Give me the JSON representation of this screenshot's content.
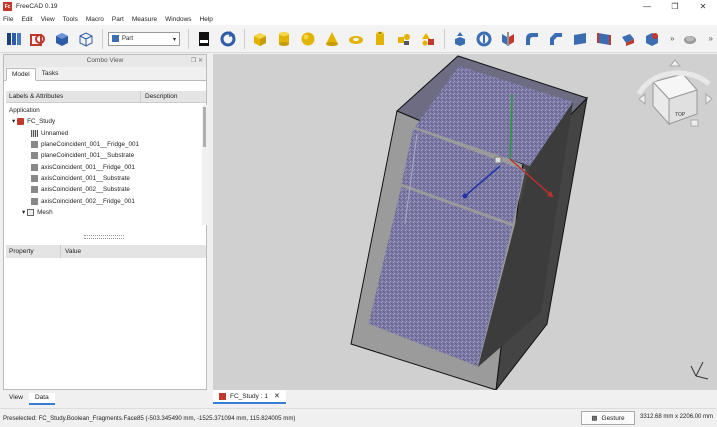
{
  "window": {
    "title": "FreeCAD 0.19",
    "app_icon": "Fc"
  },
  "menu": [
    "File",
    "Edit",
    "View",
    "Tools",
    "Macro",
    "Part",
    "Measure",
    "Windows",
    "Help"
  ],
  "toolbar": {
    "workbench": "Part",
    "icons": [
      "new-document-icon",
      "open-icon",
      "box-view-icon",
      "wireframe-icon",
      "workbench-select",
      "pdf-export-icon",
      "refresh-icon",
      "cube-icon",
      "cylinder-icon",
      "sphere-icon",
      "cone-icon",
      "torus-icon",
      "tube-icon",
      "shape-builder-icon",
      "primitives-icon",
      "extrude-icon",
      "revolve-icon",
      "mirror-icon",
      "fillet-icon",
      "chamfer-icon",
      "make-face-icon",
      "ruled-surface-icon",
      "loft-icon",
      "boolean-icon"
    ]
  },
  "combo_view": {
    "title": "Combo View",
    "tabs": [
      "Model",
      "Tasks"
    ],
    "tree_headers": [
      "Labels & Attributes",
      "Description"
    ],
    "tree_items": [
      {
        "label": "Application",
        "level": 0,
        "icon": "none"
      },
      {
        "label": "FC_Study",
        "level": 1,
        "icon": "document"
      },
      {
        "label": "Unnamed",
        "level": 2,
        "icon": "grid"
      },
      {
        "label": "planeCoincident_001__Fridge_001",
        "level": 2,
        "icon": "constraint"
      },
      {
        "label": "planeCoincident_001__Substrate",
        "level": 2,
        "icon": "constraint"
      },
      {
        "label": "axisCoincident_001__Fridge_001",
        "level": 2,
        "icon": "constraint"
      },
      {
        "label": "axisCoincident_001__Substrate",
        "level": 2,
        "icon": "constraint"
      },
      {
        "label": "axisCoincident_002__Substrate",
        "level": 2,
        "icon": "constraint"
      },
      {
        "label": "axisCoincident_002__Fridge_001",
        "level": 2,
        "icon": "constraint"
      },
      {
        "label": "Mesh",
        "level": 2,
        "icon": "mesh"
      }
    ],
    "prop_headers": [
      "Property",
      "Value"
    ],
    "bottom_tabs": [
      "View",
      "Data"
    ]
  },
  "document_tab": "FC_Study : 1",
  "status": {
    "preselected": "Preselected: FC_Study.Boolean_Fragments.Face85 (-503.345490 mm, -1525.371094 mm, 115.824005 mm)",
    "gesture": "Gesture",
    "dimensions": "3312.68 mm x 2206.00 mm"
  },
  "navcube": {
    "face": "TOP"
  },
  "colors": {
    "accent": "#3b7bd4",
    "mesh_surface": "#7a78a0",
    "background": "#d0d0d0"
  }
}
